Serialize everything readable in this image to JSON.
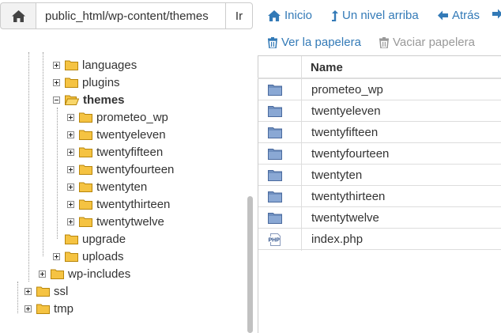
{
  "pathbar": {
    "path_value": "public_html/wp-content/themes",
    "go_label": "Ir"
  },
  "actions": {
    "home": "Inicio",
    "up_level": "Un nivel arriba",
    "back": "Atrás",
    "view_trash": "Ver la papelera",
    "empty_trash": "Vaciar papelera"
  },
  "tree": {
    "items": [
      {
        "label": "languages",
        "expander": "plus",
        "open": false,
        "bold": false
      },
      {
        "label": "plugins",
        "expander": "plus",
        "open": false,
        "bold": false
      },
      {
        "label": "themes",
        "expander": "minus",
        "open": true,
        "bold": true
      },
      {
        "label": "prometeo_wp",
        "expander": "plus",
        "open": false,
        "bold": false
      },
      {
        "label": "twentyeleven",
        "expander": "plus",
        "open": false,
        "bold": false
      },
      {
        "label": "twentyfifteen",
        "expander": "plus",
        "open": false,
        "bold": false
      },
      {
        "label": "twentyfourteen",
        "expander": "plus",
        "open": false,
        "bold": false
      },
      {
        "label": "twentyten",
        "expander": "plus",
        "open": false,
        "bold": false
      },
      {
        "label": "twentythirteen",
        "expander": "plus",
        "open": false,
        "bold": false
      },
      {
        "label": "twentytwelve",
        "expander": "plus",
        "open": false,
        "bold": false
      },
      {
        "label": "upgrade",
        "expander": "none",
        "open": false,
        "bold": false
      },
      {
        "label": "uploads",
        "expander": "plus",
        "open": false,
        "bold": false
      },
      {
        "label": "wp-includes",
        "expander": "plus",
        "open": false,
        "bold": false
      },
      {
        "label": "ssl",
        "expander": "plus",
        "open": false,
        "bold": false
      },
      {
        "label": "tmp",
        "expander": "plus",
        "open": false,
        "bold": false
      }
    ]
  },
  "file_table": {
    "header_name": "Name",
    "rows": [
      {
        "name": "prometeo_wp",
        "icon": "folder-icon"
      },
      {
        "name": "twentyeleven",
        "icon": "folder-icon"
      },
      {
        "name": "twentyfifteen",
        "icon": "folder-icon"
      },
      {
        "name": "twentyfourteen",
        "icon": "folder-icon"
      },
      {
        "name": "twentyten",
        "icon": "folder-icon"
      },
      {
        "name": "twentythirteen",
        "icon": "folder-icon"
      },
      {
        "name": "twentytwelve",
        "icon": "folder-icon"
      },
      {
        "name": "index.php",
        "icon": "php-file-icon",
        "badge": "PHP"
      }
    ]
  },
  "colors": {
    "link": "#337ab7",
    "disabled": "#999999",
    "folder_yellow": "#f5c342",
    "folder_blue": "#6f8fbf"
  }
}
